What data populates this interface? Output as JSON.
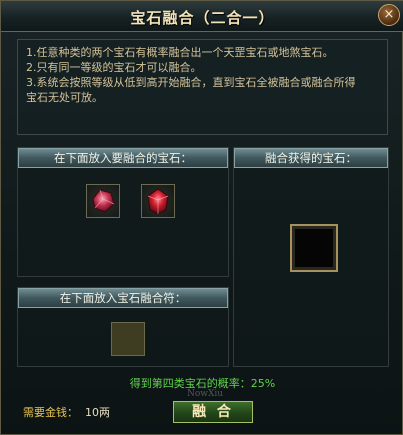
{
  "window": {
    "title": "宝石融合（二合一）",
    "close_label": "×"
  },
  "info": {
    "lines": [
      "1.任意种类的两个宝石有概率融合出一个天罡宝石或地煞宝石。",
      "2.只有同一等级的宝石才可以融合。",
      "3.系统会按照等级从低到高开始融合，直到宝石全被融合或融合所得",
      "宝石无处可放。"
    ]
  },
  "gem_panel": {
    "header": "在下面放入要融合的宝石：",
    "slots": [
      "red-gem-icon",
      "red-gem-icon"
    ]
  },
  "result_panel": {
    "header": "融合获得的宝石："
  },
  "talisman_panel": {
    "header": "在下面放入宝石融合符："
  },
  "status": {
    "probability": "得到第四类宝石的概率：25%",
    "money_label": "需要金钱：",
    "money_value": "10两"
  },
  "actions": {
    "merge_label": "融 合"
  },
  "watermark": "NowXiu",
  "colors": {
    "header_bg": "#40585d",
    "text_gold": "#e7c44c",
    "text_green": "#5fd44b",
    "border_gold": "#a6925e"
  }
}
